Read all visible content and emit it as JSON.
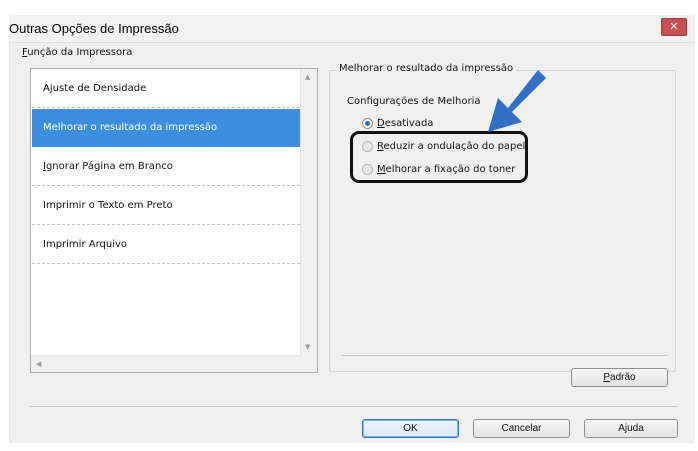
{
  "window": {
    "title": "Outras Opções de Impressão",
    "close_label": "✕"
  },
  "printer_function": {
    "group_label_underlined": "F",
    "group_label_rest": "unção da Impressora",
    "items": [
      {
        "label": "Ajuste de Densidade",
        "selected": false
      },
      {
        "label": "Melhorar o resultado da impressão",
        "selected": true
      },
      {
        "label_underlined": "I",
        "label_rest": "gnorar Página em Branco",
        "selected": false
      },
      {
        "label": "Imprimir o Texto em Preto",
        "selected": false
      },
      {
        "label": "Imprimir Arquivo",
        "selected": false
      }
    ],
    "scroll_up": "▲",
    "scroll_down": "▼",
    "scroll_left": "◀",
    "scroll_right": "▶"
  },
  "improve_panel": {
    "frame_label": "Melhorar o resultado da impressão",
    "settings_label": "Configurações de Melhoria",
    "options": [
      {
        "label_underlined": "D",
        "label_rest": "esativada",
        "checked": true
      },
      {
        "label_underlined": "R",
        "label_rest": "eduzir a ondulação do papel",
        "checked": false
      },
      {
        "label_underlined": "M",
        "label_rest": "elhorar a fixação do toner",
        "checked": false
      }
    ],
    "default_button_underlined": "P",
    "default_button_rest": "adrão"
  },
  "annotation": {
    "arrow_color": "#2f6fc4",
    "highlight_color": "#111111"
  },
  "footer": {
    "ok_label": "OK",
    "cancel_label": "Cancelar",
    "help_label": "Ajuda"
  },
  "colors": {
    "selection": "#3d8ede",
    "close_button": "#c75050"
  }
}
